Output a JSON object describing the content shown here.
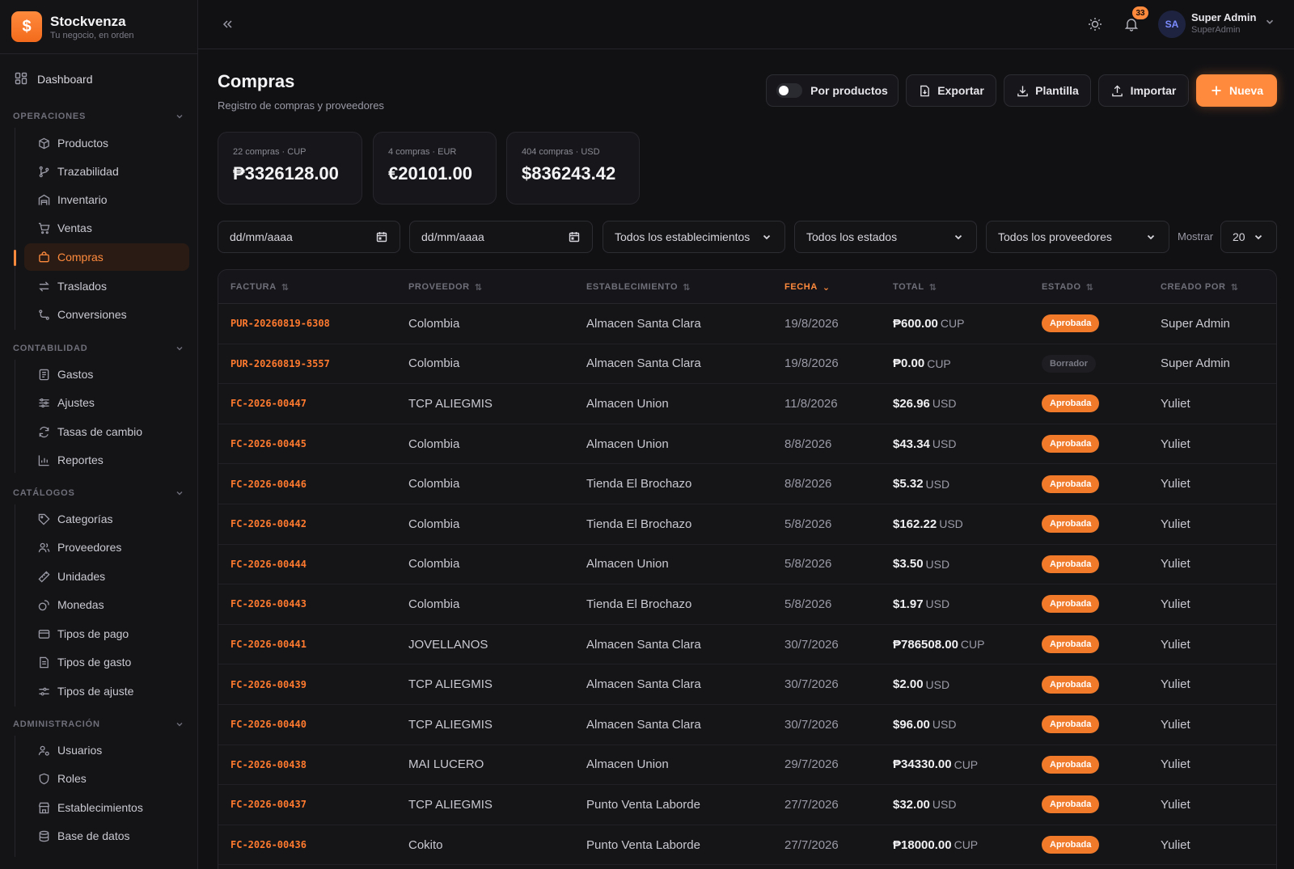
{
  "brand": {
    "name": "Stockvenza",
    "tagline": "Tu negocio, en orden",
    "logo_glyph": "$"
  },
  "sidebar": {
    "dashboard": "Dashboard",
    "sections": [
      {
        "title": "OPERACIONES",
        "items": [
          "Productos",
          "Trazabilidad",
          "Inventario",
          "Ventas",
          "Compras",
          "Traslados",
          "Conversiones"
        ]
      },
      {
        "title": "CONTABILIDAD",
        "items": [
          "Gastos",
          "Ajustes",
          "Tasas de cambio",
          "Reportes"
        ]
      },
      {
        "title": "CATÁLOGOS",
        "items": [
          "Categorías",
          "Proveedores",
          "Unidades",
          "Monedas",
          "Tipos de pago",
          "Tipos de gasto",
          "Tipos de ajuste"
        ]
      },
      {
        "title": "ADMINISTRACIÓN",
        "items": [
          "Usuarios",
          "Roles",
          "Establecimientos",
          "Base de datos"
        ]
      }
    ],
    "active_item": "Compras"
  },
  "header": {
    "notifications_count": "33",
    "avatar_initials": "SA",
    "user_name": "Super Admin",
    "user_role": "SuperAdmin"
  },
  "page": {
    "title": "Compras",
    "subtitle": "Registro de compras y proveedores"
  },
  "toolbar": {
    "toggle_label": "Por productos",
    "export_label": "Exportar",
    "template_label": "Plantilla",
    "import_label": "Importar",
    "new_label": "Nueva"
  },
  "stats": [
    {
      "label": "22 compras · CUP",
      "value": "₱3326128.00"
    },
    {
      "label": "4 compras · EUR",
      "value": "€20101.00"
    },
    {
      "label": "404 compras · USD",
      "value": "$836243.42"
    }
  ],
  "filters": {
    "date_from": "dd/mm/aaaa",
    "date_to": "dd/mm/aaaa",
    "establishment": "Todos los establecimientos",
    "status": "Todos los estados",
    "supplier": "Todos los proveedores",
    "show_label": "Mostrar",
    "page_size": "20"
  },
  "table": {
    "columns": [
      "FACTURA",
      "PROVEEDOR",
      "ESTABLECIMIENTO",
      "FECHA",
      "TOTAL",
      "ESTADO",
      "CREADO POR"
    ],
    "sorted_column": "FECHA",
    "rows": [
      {
        "invoice": "PUR-20260819-6308",
        "supplier": "Colombia",
        "establishment": "Almacen Santa Clara",
        "date": "19/8/2026",
        "amount": "₱600.00",
        "currency": "CUP",
        "status": "Aprobada",
        "created_by": "Super Admin"
      },
      {
        "invoice": "PUR-20260819-3557",
        "supplier": "Colombia",
        "establishment": "Almacen Santa Clara",
        "date": "19/8/2026",
        "amount": "₱0.00",
        "currency": "CUP",
        "status": "Borrador",
        "created_by": "Super Admin"
      },
      {
        "invoice": "FC-2026-00447",
        "supplier": "TCP ALIEGMIS",
        "establishment": "Almacen Union",
        "date": "11/8/2026",
        "amount": "$26.96",
        "currency": "USD",
        "status": "Aprobada",
        "created_by": "Yuliet"
      },
      {
        "invoice": "FC-2026-00445",
        "supplier": "Colombia",
        "establishment": "Almacen Union",
        "date": "8/8/2026",
        "amount": "$43.34",
        "currency": "USD",
        "status": "Aprobada",
        "created_by": "Yuliet"
      },
      {
        "invoice": "FC-2026-00446",
        "supplier": "Colombia",
        "establishment": "Tienda El Brochazo",
        "date": "8/8/2026",
        "amount": "$5.32",
        "currency": "USD",
        "status": "Aprobada",
        "created_by": "Yuliet"
      },
      {
        "invoice": "FC-2026-00442",
        "supplier": "Colombia",
        "establishment": "Tienda El Brochazo",
        "date": "5/8/2026",
        "amount": "$162.22",
        "currency": "USD",
        "status": "Aprobada",
        "created_by": "Yuliet"
      },
      {
        "invoice": "FC-2026-00444",
        "supplier": "Colombia",
        "establishment": "Almacen Union",
        "date": "5/8/2026",
        "amount": "$3.50",
        "currency": "USD",
        "status": "Aprobada",
        "created_by": "Yuliet"
      },
      {
        "invoice": "FC-2026-00443",
        "supplier": "Colombia",
        "establishment": "Tienda El Brochazo",
        "date": "5/8/2026",
        "amount": "$1.97",
        "currency": "USD",
        "status": "Aprobada",
        "created_by": "Yuliet"
      },
      {
        "invoice": "FC-2026-00441",
        "supplier": "JOVELLANOS",
        "establishment": "Almacen Santa Clara",
        "date": "30/7/2026",
        "amount": "₱786508.00",
        "currency": "CUP",
        "status": "Aprobada",
        "created_by": "Yuliet"
      },
      {
        "invoice": "FC-2026-00439",
        "supplier": "TCP ALIEGMIS",
        "establishment": "Almacen Santa Clara",
        "date": "30/7/2026",
        "amount": "$2.00",
        "currency": "USD",
        "status": "Aprobada",
        "created_by": "Yuliet"
      },
      {
        "invoice": "FC-2026-00440",
        "supplier": "TCP ALIEGMIS",
        "establishment": "Almacen Santa Clara",
        "date": "30/7/2026",
        "amount": "$96.00",
        "currency": "USD",
        "status": "Aprobada",
        "created_by": "Yuliet"
      },
      {
        "invoice": "FC-2026-00438",
        "supplier": "MAI LUCERO",
        "establishment": "Almacen Union",
        "date": "29/7/2026",
        "amount": "₱34330.00",
        "currency": "CUP",
        "status": "Aprobada",
        "created_by": "Yuliet"
      },
      {
        "invoice": "FC-2026-00437",
        "supplier": "TCP ALIEGMIS",
        "establishment": "Punto Venta Laborde",
        "date": "27/7/2026",
        "amount": "$32.00",
        "currency": "USD",
        "status": "Aprobada",
        "created_by": "Yuliet"
      },
      {
        "invoice": "FC-2026-00436",
        "supplier": "Cokito",
        "establishment": "Punto Venta Laborde",
        "date": "27/7/2026",
        "amount": "₱18000.00",
        "currency": "CUP",
        "status": "Aprobada",
        "created_by": "Yuliet"
      }
    ]
  },
  "colors": {
    "accent": "#ff8a3d",
    "background": "#111114",
    "sidebar": "#141417"
  }
}
